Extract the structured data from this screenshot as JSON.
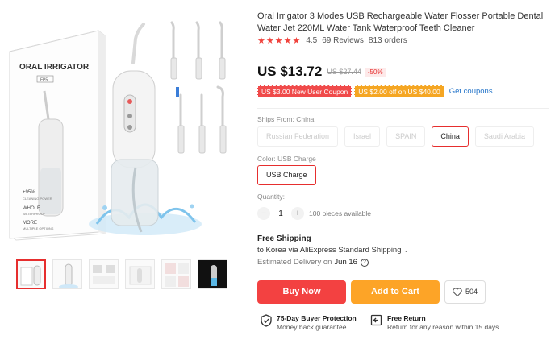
{
  "gallery": {
    "box_brand": "ORAL IRRIGATOR",
    "box_model": "FP5",
    "box_features": [
      "+95%",
      "CLEANING POWER",
      "WHOLE",
      "WATERPROOF",
      "MORE",
      "MULTIPLE OPTIONS"
    ],
    "thumbnail_count": 6
  },
  "product": {
    "title": "Oral Irrigator 3 Modes USB Rechargeable Water Flosser Portable Dental Water Jet 220ML Water Tank Waterproof Teeth Cleaner",
    "rating": "4.5",
    "reviews": "69 Reviews",
    "orders": "813 orders",
    "price": "US $13.72",
    "old_price": "US $27.44",
    "discount": "-50%",
    "coupons": [
      "US $3.00 New User Coupon",
      "US $2.00 off on US $40.00"
    ],
    "get_coupons": "Get coupons"
  },
  "ships_from": {
    "label": "Ships From:",
    "value": "China",
    "options": [
      "Russian Federation",
      "Israel",
      "SPAIN",
      "China",
      "Saudi Arabia"
    ],
    "selected": "China"
  },
  "color": {
    "label": "Color:",
    "value": "USB Charge",
    "options": [
      "USB Charge"
    ]
  },
  "quantity": {
    "label": "Quantity:",
    "value": "1",
    "minus": "−",
    "plus": "+",
    "available": "100 pieces available"
  },
  "shipping": {
    "title": "Free Shipping",
    "destination": "to Korea via AliExpress Standard Shipping",
    "estimated_label": "Estimated Delivery on",
    "estimated_date": "Jun 16"
  },
  "actions": {
    "buy_now": "Buy Now",
    "add_to_cart": "Add to Cart",
    "wishlist_count": "504"
  },
  "guarantees": [
    {
      "title": "75-Day Buyer Protection",
      "subtitle": "Money back guarantee",
      "icon": "shield-check-icon"
    },
    {
      "title": "Free Return",
      "subtitle": "Return for any reason within 15 days",
      "icon": "return-icon"
    }
  ],
  "colors": {
    "accent": "#e62e2e",
    "buy": "#f34141",
    "cart": "#fda427",
    "link": "#2575c9"
  }
}
